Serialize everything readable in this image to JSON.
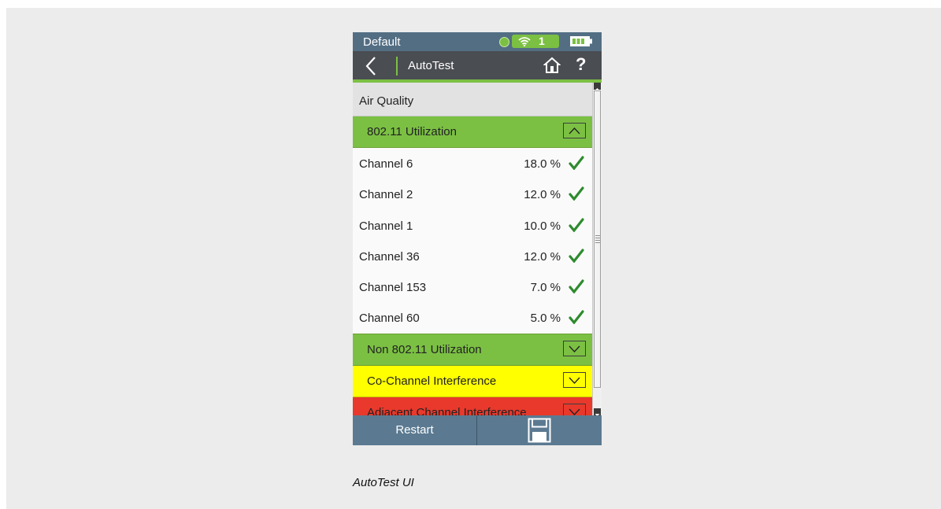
{
  "status_bar": {
    "profile": "Default",
    "wifi_count": "1",
    "led_color": "#7bc043"
  },
  "nav": {
    "title": "AutoTest",
    "back_icon": "chevron-left-icon",
    "home_icon": "home-icon",
    "help_label": "?"
  },
  "section": {
    "title": "Air Quality"
  },
  "groups": [
    {
      "label": "802.11 Utilization",
      "color": "#7bc043",
      "expanded": true,
      "rows": [
        {
          "label": "Channel 6",
          "value": "18.0 %"
        },
        {
          "label": "Channel 2",
          "value": "12.0 %"
        },
        {
          "label": "Channel 1",
          "value": "10.0 %"
        },
        {
          "label": "Channel 36",
          "value": "12.0 %"
        },
        {
          "label": "Channel 153",
          "value": "7.0 %"
        },
        {
          "label": "Channel 60",
          "value": "5.0 %"
        }
      ]
    },
    {
      "label": "Non 802.11 Utilization",
      "color": "#7bc043",
      "expanded": false
    },
    {
      "label": "Co-Channel Interference",
      "color": "#ffff00",
      "expanded": false
    },
    {
      "label": "Adjacent Channel Interference",
      "color": "#e8392c",
      "expanded": false
    }
  ],
  "bottom_bar": {
    "restart_label": "Restart",
    "save_icon": "floppy-disk-icon"
  },
  "caption": "AutoTest UI",
  "colors": {
    "status_bar": "#536e83",
    "nav_bar": "#4a4d52",
    "accent_green": "#7bc043",
    "check_green": "#2e8b2e",
    "bottom_bar": "#5b7a91"
  }
}
